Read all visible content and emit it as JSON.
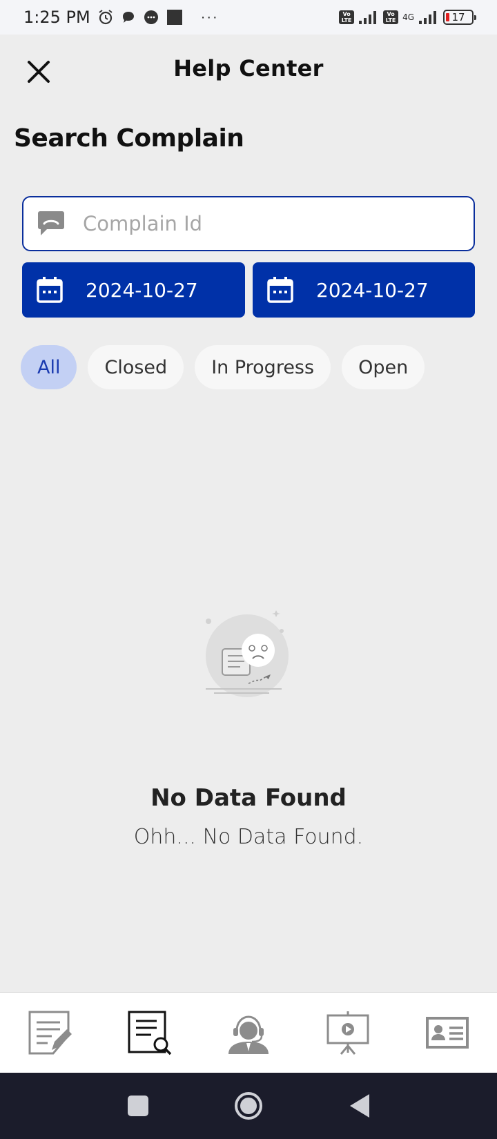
{
  "status_bar": {
    "time": "1:25 PM",
    "more": "···",
    "network": "4G",
    "volte": "Vo LTE",
    "battery": "17"
  },
  "header": {
    "title": "Help Center"
  },
  "page": {
    "title": "Search Complain"
  },
  "search": {
    "placeholder": "Complain Id",
    "value": ""
  },
  "dates": {
    "start": "2024-10-27",
    "end": "2024-10-27"
  },
  "filters": [
    {
      "label": "All",
      "active": true
    },
    {
      "label": "Closed",
      "active": false
    },
    {
      "label": "In Progress",
      "active": false
    },
    {
      "label": "Open",
      "active": false
    }
  ],
  "empty_state": {
    "title": "No Data Found",
    "subtitle": "Ohh... No Data Found."
  },
  "bottom_nav": {
    "items": [
      {
        "icon": "edit-document-icon",
        "active": false
      },
      {
        "icon": "search-document-icon",
        "active": true
      },
      {
        "icon": "customer-support-icon",
        "active": false
      },
      {
        "icon": "presentation-video-icon",
        "active": false
      },
      {
        "icon": "contact-card-icon",
        "active": false
      }
    ]
  },
  "colors": {
    "primary": "#0031a8",
    "chip_active_bg": "#c3d0f4",
    "background": "#ededed"
  }
}
